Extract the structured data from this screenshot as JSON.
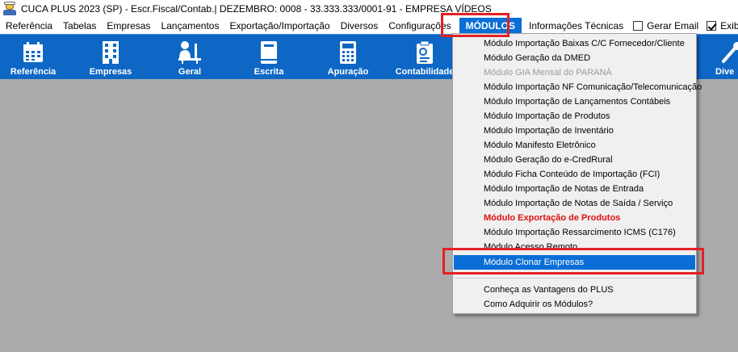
{
  "window": {
    "title": "CUCA PLUS 2023 (SP) - Escr.Fiscal/Contab.| DEZEMBRO: 0008 - 33.333.333/0001-91 - EMPRESA VÍDEOS"
  },
  "menubar": {
    "items": [
      "Referência",
      "Tabelas",
      "Empresas",
      "Lançamentos",
      "Exportação/Importação",
      "Diversos",
      "Configurações"
    ],
    "active": "MÓDULOS",
    "info": "Informações Técnicas",
    "gerar_email": "Gerar Email",
    "exibir_barra": "Exibir Barra"
  },
  "toolbar": {
    "items": [
      "Referência",
      "Empresas",
      "Geral",
      "Escrita",
      "Apuração",
      "Contabilidade",
      "Dive"
    ]
  },
  "modulos_menu": {
    "items": [
      "Módulo Importação Baixas C/C Fornecedor/Cliente",
      "Módulo Geração da DMED",
      "Módulo GIA Mensal do PARANÁ",
      "Módulo Importação NF Comunicação/Telecomunicação",
      "Módulo Importação de Lançamentos Contábeis",
      "Módulo Importação de Produtos",
      "Módulo Importação de Inventário",
      "Módulo Manifesto Eletrônico",
      "Módulo Geração do e-CredRural",
      "Módulo Ficha Conteúdo de Importação (FCI)",
      "Módulo Importação de Notas de Entrada",
      "Módulo Importação de Notas de Saída / Serviço",
      "Módulo Exportação de Produtos",
      "Módulo Importação Ressarcimento ICMS (C176)",
      "Módulo Acesso Remoto",
      "Módulo Clonar Empresas"
    ],
    "footer_items": [
      "Conheça as Vantagens do PLUS",
      "Como Adquirir os Módulos?"
    ]
  },
  "colors": {
    "toolbar_bg": "#0e67c4",
    "selection": "#0a6ed6",
    "highlight_box": "#e32027",
    "emphasis_text": "#e01010"
  },
  "icons": [
    "app-logo-icon",
    "calendar-icon",
    "building-icon",
    "user-desk-icon",
    "book-icon",
    "calculator-icon",
    "ledger-icon"
  ]
}
